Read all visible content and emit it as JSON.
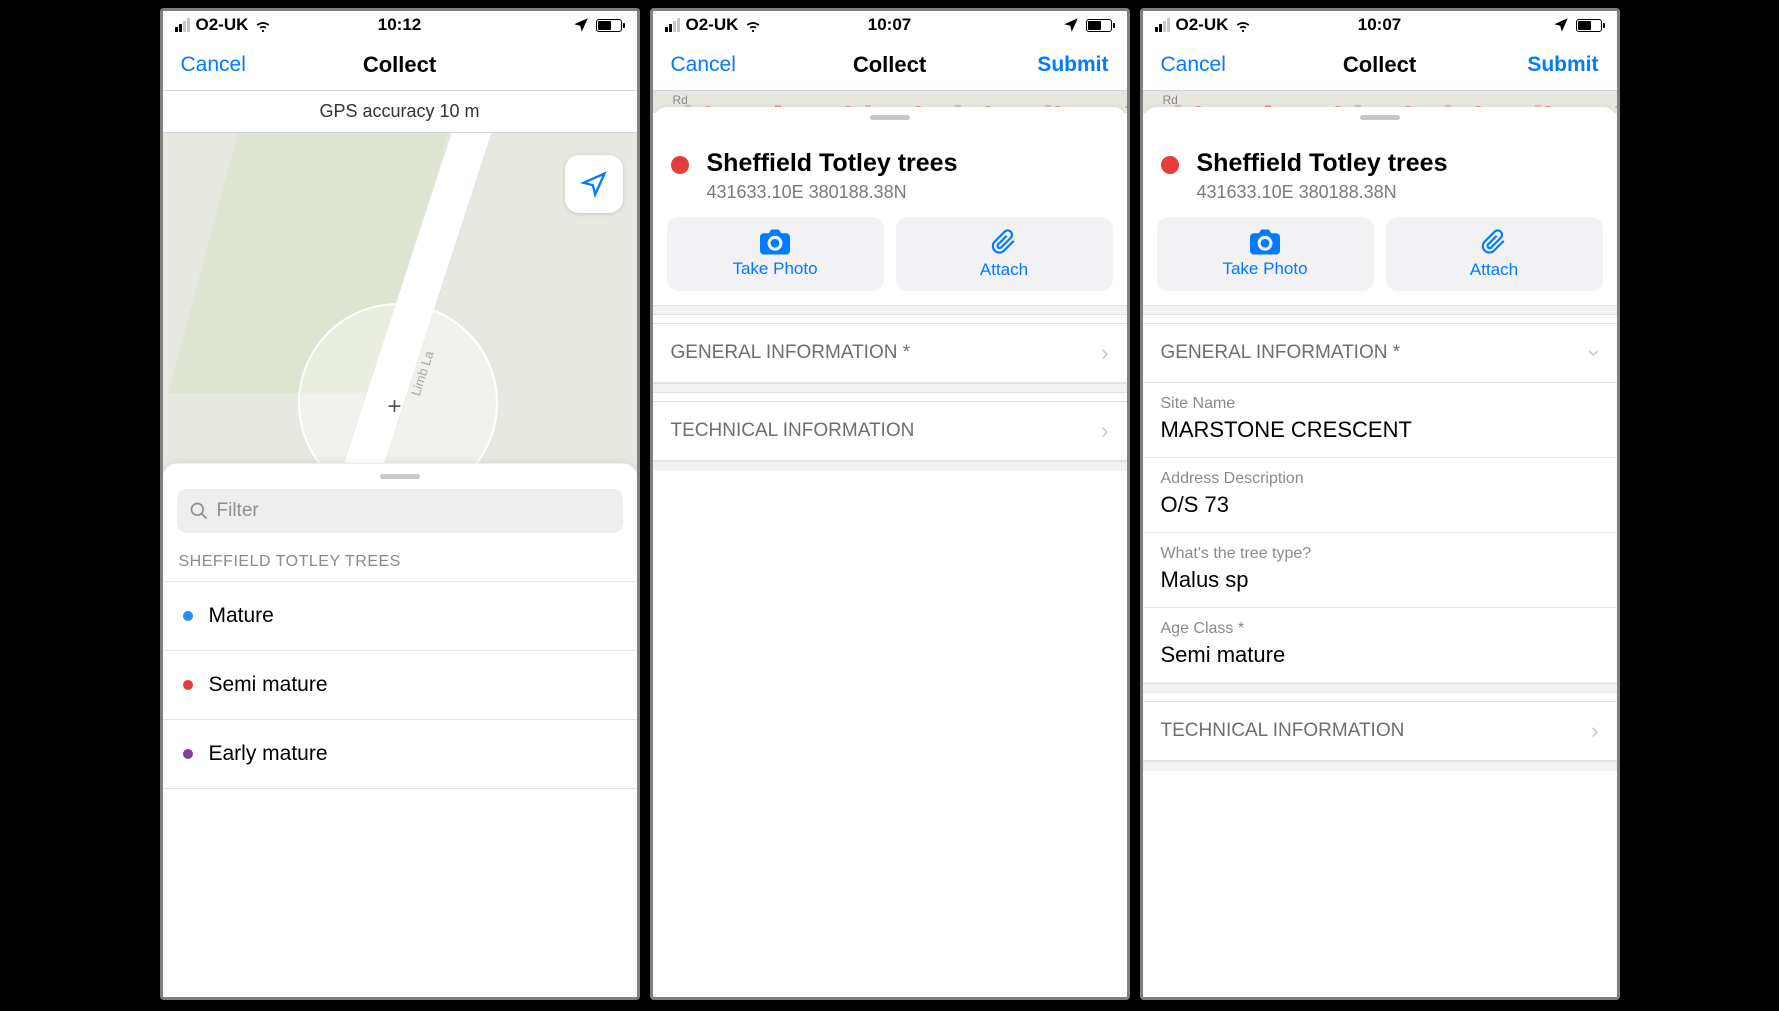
{
  "screens": [
    {
      "status": {
        "carrier": "O2-UK",
        "time": "10:12"
      },
      "nav": {
        "left": "Cancel",
        "title": "Collect",
        "right": ""
      },
      "gps": "GPS accuracy 10 m",
      "map_road": "Limb La",
      "filter_placeholder": "Filter",
      "section": "SHEFFIELD TOTLEY TREES",
      "cats": [
        {
          "label": "Mature",
          "color": "#1e90ff"
        },
        {
          "label": "Semi mature",
          "color": "#e43b3b"
        },
        {
          "label": "Early mature",
          "color": "#8a3fa0"
        }
      ]
    },
    {
      "status": {
        "carrier": "O2-UK",
        "time": "10:07"
      },
      "nav": {
        "left": "Cancel",
        "title": "Collect",
        "right": "Submit"
      },
      "map_label": "Rd",
      "card": {
        "title": "Sheffield Totley trees",
        "sub": "431633.10E 380188.38N"
      },
      "buttons": {
        "photo": "Take Photo",
        "attach": "Attach"
      },
      "sections": {
        "general": "GENERAL INFORMATION *",
        "technical": "TECHNICAL INFORMATION"
      }
    },
    {
      "status": {
        "carrier": "O2-UK",
        "time": "10:07"
      },
      "nav": {
        "left": "Cancel",
        "title": "Collect",
        "right": "Submit"
      },
      "map_label": "Rd",
      "card": {
        "title": "Sheffield Totley trees",
        "sub": "431633.10E 380188.38N"
      },
      "buttons": {
        "photo": "Take Photo",
        "attach": "Attach"
      },
      "sections": {
        "general": "GENERAL INFORMATION *",
        "technical": "TECHNICAL INFORMATION"
      },
      "fields": [
        {
          "label": "Site Name",
          "value": "MARSTONE CRESCENT"
        },
        {
          "label": "Address Description",
          "value": "O/S 73"
        },
        {
          "label": "What's the tree type?",
          "value": "Malus sp"
        },
        {
          "label": "Age Class *",
          "value": "Semi mature"
        }
      ]
    }
  ]
}
